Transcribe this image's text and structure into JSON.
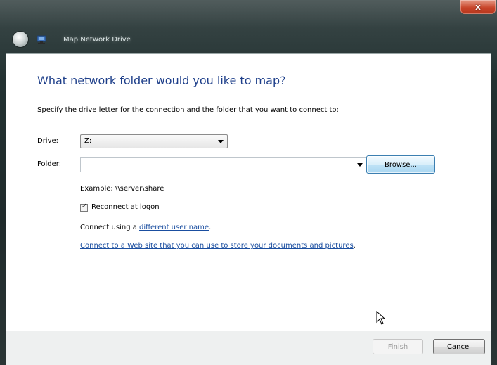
{
  "window": {
    "title": "Map Network Drive",
    "close_symbol": "x"
  },
  "content": {
    "heading": "What network folder would you like to map?",
    "instruction": "Specify the drive letter for the connection and the folder that you want to connect to:",
    "drive": {
      "label": "Drive:",
      "value": "Z:"
    },
    "folder": {
      "label": "Folder:",
      "value": ""
    },
    "browse_label": "Browse...",
    "example": "Example: \\\\server\\share",
    "reconnect": {
      "label": "Reconnect at logon",
      "checked": true
    },
    "connect_using": {
      "prefix": "Connect using a ",
      "link": "different user name",
      "suffix": "."
    },
    "web_link": "Connect to a Web site that you can use to store your documents and pictures",
    "web_link_suffix": "."
  },
  "footer": {
    "finish_label": "Finish",
    "cancel_label": "Cancel"
  },
  "icons": {
    "back": "back-arrow-icon",
    "title": "network-drive-icon",
    "caret": "chevron-down-icon",
    "checkmark": "checkmark-icon",
    "cursor": "mouse-pointer-icon"
  },
  "colors": {
    "heading": "#1e3f8a",
    "link": "#1a4ea0",
    "close": "#c8452a",
    "browse_highlight": "#a9d7f1"
  }
}
